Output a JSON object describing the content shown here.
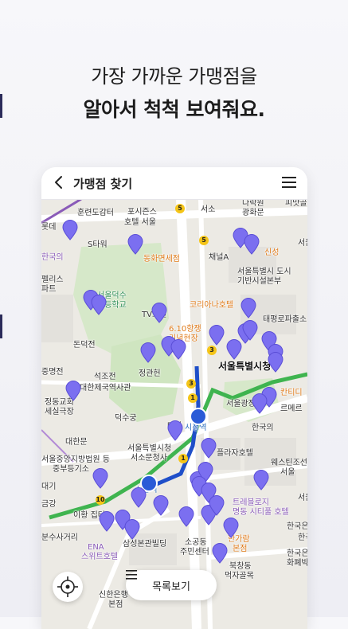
{
  "headline": {
    "line1": "가장 가까운 가맹점을",
    "line2": "알아서 척척 보여줘요."
  },
  "appbar": {
    "title": "가맹점 찾기",
    "back_icon": "chevron-left-icon",
    "menu_icon": "hamburger-menu-icon"
  },
  "map": {
    "labels": [
      {
        "text": "훈련도감터"
      },
      {
        "text": "포시즌스"
      },
      {
        "text": "호텔 서울"
      },
      {
        "text": "S타워"
      },
      {
        "text": "동화면세점"
      },
      {
        "text": "채널A"
      },
      {
        "text": "서울특별시 도시"
      },
      {
        "text": "기반시설본부"
      },
      {
        "text": "신성"
      },
      {
        "text": "펠리스"
      },
      {
        "text": "파트"
      },
      {
        "text": "서울덕수"
      },
      {
        "text": "초등학교"
      },
      {
        "text": "코리아나호텔"
      },
      {
        "text": "TV조선"
      },
      {
        "text": "6.10항쟁"
      },
      {
        "text": "기념현장"
      },
      {
        "text": "태평로파출소"
      },
      {
        "text": "돈덕전"
      },
      {
        "text": "중명전"
      },
      {
        "text": "석조전"
      },
      {
        "text": "정관헌"
      },
      {
        "text": "대한제국역사관"
      },
      {
        "text": "서울특별시청"
      },
      {
        "text": "정동교회"
      },
      {
        "text": "세실극장"
      },
      {
        "text": "덕수궁"
      },
      {
        "text": "서울광장"
      },
      {
        "text": "르메르"
      },
      {
        "text": "칸티디"
      },
      {
        "text": "한국의"
      },
      {
        "text": "시청역"
      },
      {
        "text": "서울특별시청"
      },
      {
        "text": "서소문청사"
      },
      {
        "text": "플라자호텔"
      },
      {
        "text": "웨스틴조선"
      },
      {
        "text": "서울"
      },
      {
        "text": "서울중앙지방법원 등"
      },
      {
        "text": "중부등기소"
      },
      {
        "text": "이황 집터"
      },
      {
        "text": "트레블로지"
      },
      {
        "text": "명동 시티풀 호텔"
      },
      {
        "text": "한국은"
      },
      {
        "text": "ENA"
      },
      {
        "text": "스위트호텔"
      },
      {
        "text": "삼성본관빌딩"
      },
      {
        "text": "소공동"
      },
      {
        "text": "주민센터"
      },
      {
        "text": "한가람"
      },
      {
        "text": "본점"
      },
      {
        "text": "한국은"
      },
      {
        "text": "화폐박"
      },
      {
        "text": "북창동"
      },
      {
        "text": "먹자골목"
      },
      {
        "text": "신한은행"
      },
      {
        "text": "본점"
      },
      {
        "text": "롯데"
      },
      {
        "text": "광화문"
      },
      {
        "text": "다락원"
      },
      {
        "text": "피맛골"
      },
      {
        "text": "서소"
      },
      {
        "text": "서울시"
      },
      {
        "text": "한국의"
      },
      {
        "text": "서울광장"
      },
      {
        "text": "대한"
      },
      {
        "text": "대한문"
      },
      {
        "text": "대기"
      },
      {
        "text": "금강"
      },
      {
        "text": "분수사거리"
      },
      {
        "text": "시청역"
      },
      {
        "text": "한국"
      }
    ]
  },
  "controls": {
    "list_button_label": "목록보기",
    "list_icon": "list-icon",
    "location_icon": "current-location-icon"
  },
  "colors": {
    "pin": "#7b6ff0",
    "line1_subway": "#1f4fc9",
    "line2_subway": "#3fb44f",
    "park": "#cfe5c0"
  }
}
